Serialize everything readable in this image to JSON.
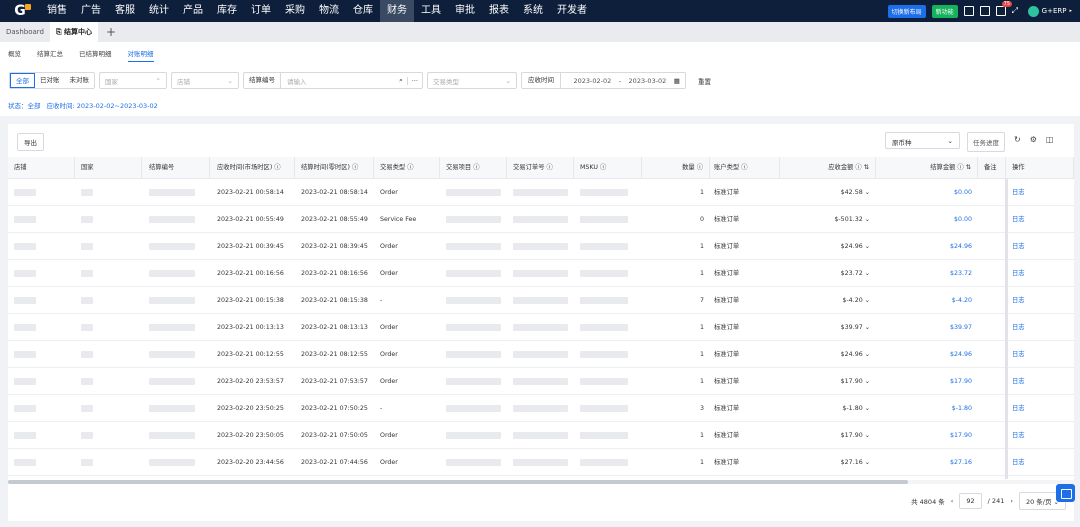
{
  "nav": {
    "logo": "G",
    "items": [
      "销售",
      "广告",
      "客服",
      "统计",
      "产品",
      "库存",
      "订单",
      "采购",
      "物流",
      "仓库",
      "财务",
      "工具",
      "审批",
      "报表",
      "系统",
      "开发者"
    ],
    "active_index": 10,
    "btn_layout": "切换新布局",
    "btn_new": "新功能",
    "notif_count": "75",
    "user": "G+ERP"
  },
  "page_tabs": {
    "dashboard": "Dashboard",
    "current": "结算中心",
    "plus": "+"
  },
  "subtabs": [
    "概览",
    "结算汇总",
    "已结算明细",
    "对账明细"
  ],
  "subtab_active": 3,
  "filters": {
    "seg": [
      "全部",
      "已对账",
      "未对账"
    ],
    "country": "国家",
    "shop": "店铺",
    "settle_no_label": "结算编号",
    "settle_no_placeholder": "请输入",
    "more": "···",
    "trade_type": "交易类型",
    "date_label": "应收时间",
    "date_from": "2023-02-02",
    "date_sep": "-",
    "date_to": "2023-03-02",
    "reset": "重置"
  },
  "status": {
    "state": "状态：全部",
    "date": "应收时间: 2023-02-02~2023-03-02"
  },
  "toolbar": {
    "export": "导出",
    "currency": "原币种",
    "task": "任务进度"
  },
  "columns": [
    "店铺",
    "国家",
    "结算编号",
    "应收时间(市场时区)",
    "结算时间(零时区)",
    "交易类型",
    "交易项目",
    "交易订单号",
    "MSKU",
    "数量",
    "账户类型",
    "应收金额",
    "结算金额",
    "备注",
    "操作"
  ],
  "rows": [
    {
      "recv": "2023-02-21 00:58:14",
      "settle": "2023-02-21 08:58:14",
      "type": "Order",
      "qty": "1",
      "acct": "标准订单",
      "recv_amt": "$42.58",
      "settle_amt": "$0.00",
      "op": "日志"
    },
    {
      "recv": "2023-02-21 00:55:49",
      "settle": "2023-02-21 08:55:49",
      "type": "Service Fee",
      "qty": "0",
      "acct": "标准订单",
      "recv_amt": "$-501.32",
      "settle_amt": "$0.00",
      "op": "日志"
    },
    {
      "recv": "2023-02-21 00:39:45",
      "settle": "2023-02-21 08:39:45",
      "type": "Order",
      "qty": "1",
      "acct": "标准订单",
      "recv_amt": "$24.96",
      "settle_amt": "$24.96",
      "op": "日志"
    },
    {
      "recv": "2023-02-21 00:16:56",
      "settle": "2023-02-21 08:16:56",
      "type": "Order",
      "qty": "1",
      "acct": "标准订单",
      "recv_amt": "$23.72",
      "settle_amt": "$23.72",
      "op": "日志"
    },
    {
      "recv": "2023-02-21 00:15:38",
      "settle": "2023-02-21 08:15:38",
      "type": "-",
      "qty": "7",
      "acct": "标准订单",
      "recv_amt": "$-4.20",
      "settle_amt": "$-4.20",
      "op": "日志"
    },
    {
      "recv": "2023-02-21 00:13:13",
      "settle": "2023-02-21 08:13:13",
      "type": "Order",
      "qty": "1",
      "acct": "标准订单",
      "recv_amt": "$39.97",
      "settle_amt": "$39.97",
      "op": "日志"
    },
    {
      "recv": "2023-02-21 00:12:55",
      "settle": "2023-02-21 08:12:55",
      "type": "Order",
      "qty": "1",
      "acct": "标准订单",
      "recv_amt": "$24.96",
      "settle_amt": "$24.96",
      "op": "日志"
    },
    {
      "recv": "2023-02-20 23:53:57",
      "settle": "2023-02-21 07:53:57",
      "type": "Order",
      "qty": "1",
      "acct": "标准订单",
      "recv_amt": "$17.90",
      "settle_amt": "$17.90",
      "op": "日志"
    },
    {
      "recv": "2023-02-20 23:50:25",
      "settle": "2023-02-21 07:50:25",
      "type": "-",
      "qty": "3",
      "acct": "标准订单",
      "recv_amt": "$-1.80",
      "settle_amt": "$-1.80",
      "op": "日志"
    },
    {
      "recv": "2023-02-20 23:50:05",
      "settle": "2023-02-21 07:50:05",
      "type": "Order",
      "qty": "1",
      "acct": "标准订单",
      "recv_amt": "$17.90",
      "settle_amt": "$17.90",
      "op": "日志"
    },
    {
      "recv": "2023-02-20 23:44:56",
      "settle": "2023-02-21 07:44:56",
      "type": "Order",
      "qty": "1",
      "acct": "标准订单",
      "recv_amt": "$27.16",
      "settle_amt": "$27.16",
      "op": "日志"
    }
  ],
  "pager": {
    "total": "共 4804 条",
    "page": "92",
    "pages": "/ 241",
    "size": "20 条/页"
  }
}
